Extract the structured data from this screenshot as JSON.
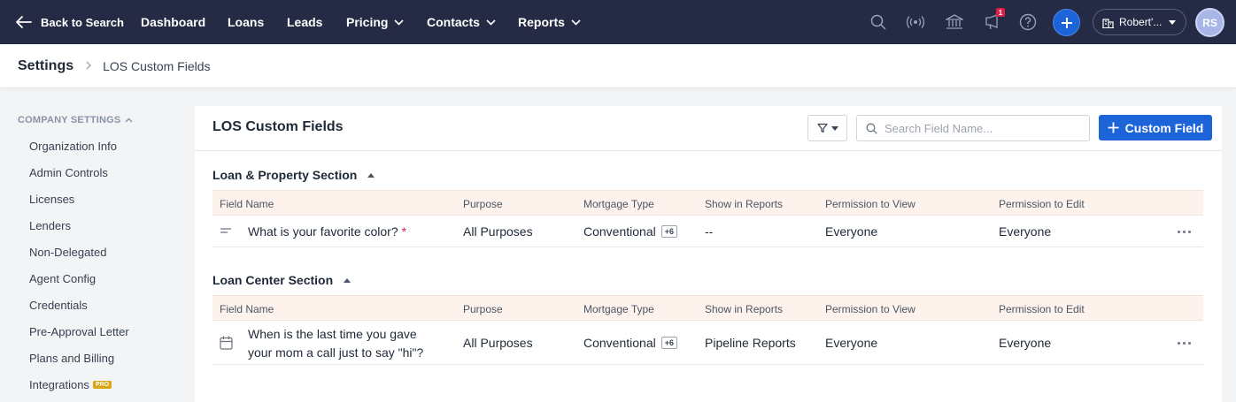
{
  "nav": {
    "back_label": "Back to Search",
    "items": [
      {
        "label": "Dashboard",
        "dropdown": false
      },
      {
        "label": "Loans",
        "dropdown": false
      },
      {
        "label": "Leads",
        "dropdown": false
      },
      {
        "label": "Pricing",
        "dropdown": true
      },
      {
        "label": "Contacts",
        "dropdown": true
      },
      {
        "label": "Reports",
        "dropdown": true
      }
    ],
    "notification_count": "1",
    "org_label": "Robert'...",
    "avatar_initials": "RS"
  },
  "breadcrumb": {
    "root": "Settings",
    "current": "LOS Custom Fields"
  },
  "sidebar": {
    "heading": "COMPANY SETTINGS",
    "items": [
      {
        "label": "Organization Info"
      },
      {
        "label": "Admin Controls"
      },
      {
        "label": "Licenses"
      },
      {
        "label": "Lenders"
      },
      {
        "label": "Non-Delegated"
      },
      {
        "label": "Agent Config"
      },
      {
        "label": "Credentials"
      },
      {
        "label": "Pre-Approval Letter"
      },
      {
        "label": "Plans and Billing"
      },
      {
        "label": "Integrations",
        "badge": "PRO"
      }
    ]
  },
  "main": {
    "title": "LOS Custom Fields",
    "search_placeholder": "Search Field Name...",
    "add_button": "Custom Field",
    "columns": [
      "Field Name",
      "Purpose",
      "Mortgage Type",
      "Show in Reports",
      "Permission to View",
      "Permission to Edit"
    ],
    "sections": [
      {
        "title": "Loan & Property Section",
        "rows": [
          {
            "icon": "text-lines-icon",
            "field_line1": "What is your favorite color?",
            "field_line2": "",
            "required_mark": "*",
            "purpose": "All Purposes",
            "mortgage_type": "Conventional",
            "mortgage_extra": "+6",
            "show_in_reports": "--",
            "permission_view": "Everyone",
            "permission_edit": "Everyone"
          }
        ]
      },
      {
        "title": "Loan Center Section",
        "rows": [
          {
            "icon": "calendar-icon",
            "field_line1": "When is the last time you gave",
            "field_line2": "your mom a call just to say \"hi\"?",
            "required_mark": "",
            "purpose": "All Purposes",
            "mortgage_type": "Conventional",
            "mortgage_extra": "+6",
            "show_in_reports": "Pipeline Reports",
            "permission_view": "Everyone",
            "permission_edit": "Everyone"
          }
        ]
      }
    ]
  },
  "colors": {
    "nav_bg": "#262b45",
    "primary": "#1d64d9",
    "table_header_bg": "#fdf3ec",
    "required": "#e11d48",
    "pro_badge": "#d9a514"
  }
}
